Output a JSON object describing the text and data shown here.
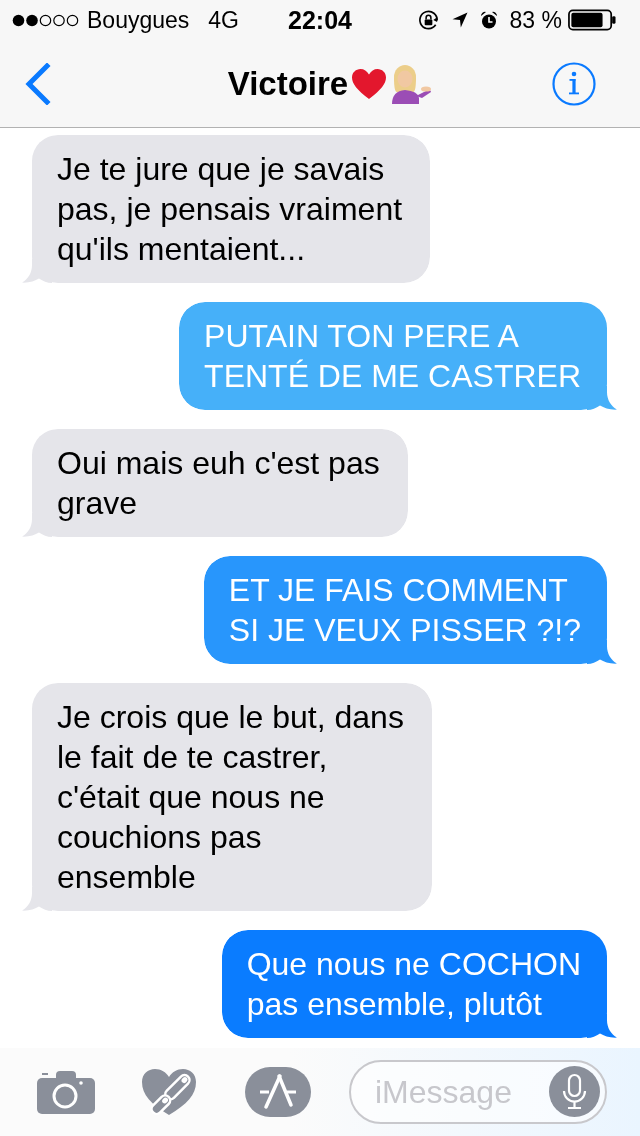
{
  "status_bar": {
    "carrier": "Bouygues",
    "network": "4G",
    "time": "22:04",
    "battery": "83 %"
  },
  "nav_bar": {
    "title": "Victoire"
  },
  "messages": [
    {
      "kind": "received",
      "text": "Je te jure que je savais\npas, je pensais vraiment\nqu'ils mentaient..."
    },
    {
      "kind": "sent",
      "text": "PUTAIN TON PERE A\nTENTÉ DE ME CASTRER"
    },
    {
      "kind": "received",
      "text": "Oui mais euh c'est pas\ngrave"
    },
    {
      "kind": "sent",
      "text": "ET JE FAIS COMMENT\nSI JE VEUX PISSER ?!?"
    },
    {
      "kind": "received",
      "text": "Je crois que le but, dans\nle fait de te castrer,\nc'était que nous ne\ncouchions pas\nensemble"
    },
    {
      "kind": "sent",
      "text": "Que nous ne COCHON\npas ensemble, plutôt"
    }
  ],
  "input_bar": {
    "placeholder": "iMessage"
  }
}
